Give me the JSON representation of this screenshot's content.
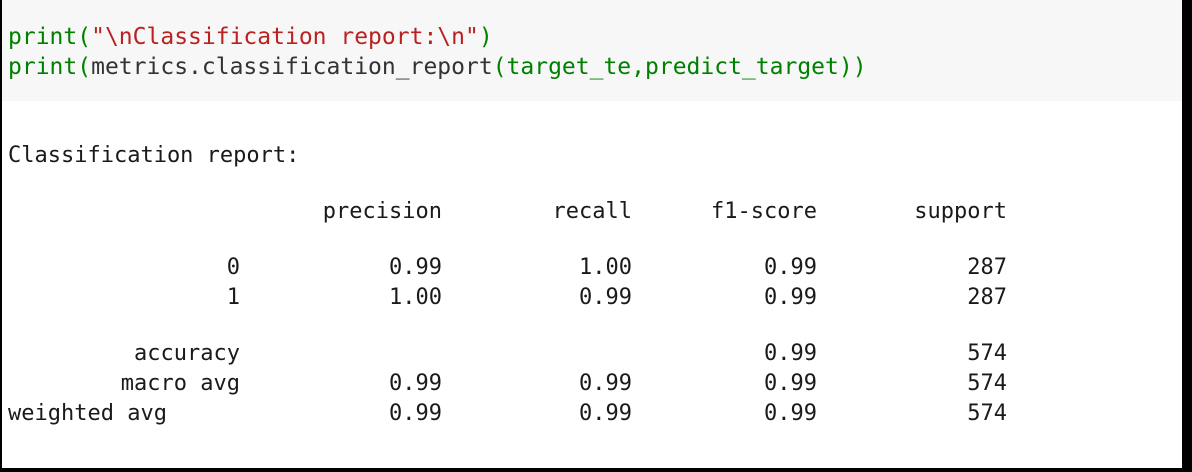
{
  "code": {
    "line1": {
      "fn": "print",
      "open": "(",
      "string": "\"\\nClassification report:\\n\"",
      "close": ")"
    },
    "line2": {
      "fn": "print",
      "open": "(",
      "call": "metrics.classification_report",
      "args": "(target_te,predict_target)",
      "close": ")"
    }
  },
  "output": {
    "heading": "Classification report:",
    "columns": [
      "precision",
      "recall",
      "f1-score",
      "support"
    ],
    "rows": [
      {
        "label": "0",
        "precision": "0.99",
        "recall": "1.00",
        "f1": "0.99",
        "support": "287"
      },
      {
        "label": "1",
        "precision": "1.00",
        "recall": "0.99",
        "f1": "0.99",
        "support": "287"
      }
    ],
    "summary": [
      {
        "label": "accuracy",
        "precision": "",
        "recall": "",
        "f1": "0.99",
        "support": "574"
      },
      {
        "label": "macro avg",
        "precision": "0.99",
        "recall": "0.99",
        "f1": "0.99",
        "support": "574"
      },
      {
        "label": "weighted avg",
        "precision": "0.99",
        "recall": "0.99",
        "f1": "0.99",
        "support": "574"
      }
    ]
  }
}
